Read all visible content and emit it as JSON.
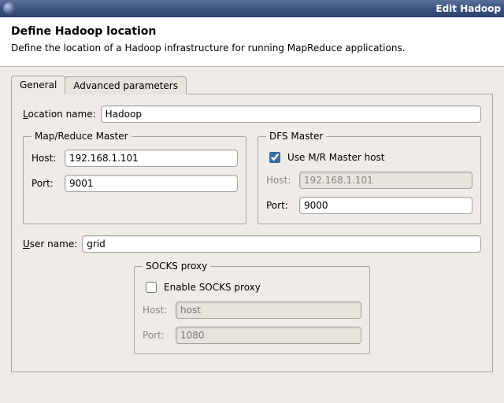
{
  "window": {
    "title": "Edit Hadoop"
  },
  "header": {
    "title": "Define Hadoop location",
    "subtitle": "Define the location of a Hadoop infrastructure for running MapReduce applications."
  },
  "tabs": {
    "general": "General",
    "advanced": "Advanced parameters"
  },
  "form": {
    "location_label": "Location name:",
    "location_value": "Hadoop",
    "mr_master": {
      "legend": "Map/Reduce Master",
      "host_label": "Host:",
      "host_value": "192.168.1.101",
      "port_label": "Port:",
      "port_value": "9001"
    },
    "dfs_master": {
      "legend": "DFS Master",
      "use_mr_label": "Use M/R Master host",
      "use_mr_checked": true,
      "host_label": "Host:",
      "host_value": "192.168.1.101",
      "port_label": "Port:",
      "port_value": "9000"
    },
    "user_label": "User name:",
    "user_value": "grid",
    "socks": {
      "legend": "SOCKS proxy",
      "enable_label": "Enable SOCKS proxy",
      "enable_checked": false,
      "host_label": "Host:",
      "host_placeholder": "host",
      "port_label": "Port:",
      "port_placeholder": "1080"
    }
  }
}
